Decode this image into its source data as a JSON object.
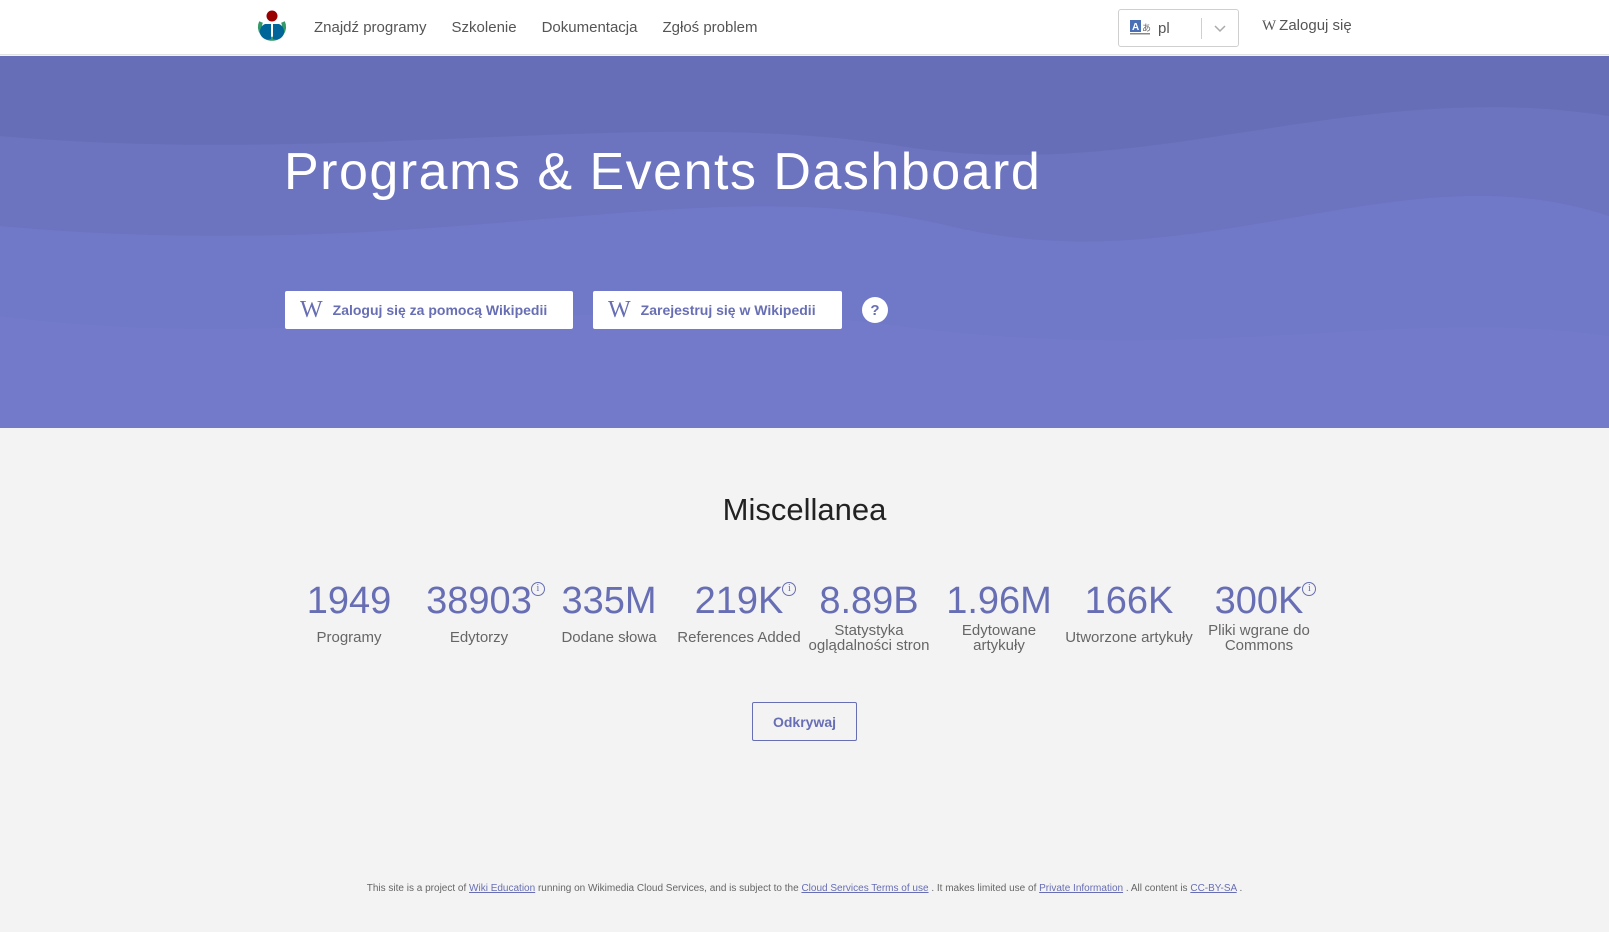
{
  "nav": {
    "links": [
      "Znajdź programy",
      "Szkolenie",
      "Dokumentacja",
      "Zgłoś problem"
    ],
    "language_value": "pl",
    "login_label": "Zaloguj się",
    "wiki_glyph": "W"
  },
  "hero": {
    "title": "Programs & Events Dashboard",
    "login_button": "Zaloguj się za pomocą Wikipedii",
    "register_button": "Zarejestruj się w Wikipedii",
    "help_label": "?"
  },
  "stats": {
    "title": "Miscellanea",
    "info_glyph": "i",
    "items": [
      {
        "value": "1949",
        "label": "Programy"
      },
      {
        "value": "38903",
        "label": "Edytorzy"
      },
      {
        "value": "335M",
        "label": "Dodane słowa"
      },
      {
        "value": "219K",
        "label": "References Added"
      },
      {
        "value": "8.89B",
        "label_line1": "Statystyka",
        "label_line2": "oglądalności stron"
      },
      {
        "value": "1.96M",
        "label_line1": "Edytowane",
        "label_line2": "artykuły"
      },
      {
        "value": "166K",
        "label": "Utworzone artykuły"
      },
      {
        "value": "300K",
        "label_line1": "Pliki wgrane do",
        "label_line2": "Commons"
      }
    ],
    "explore_button": "Odkrywaj"
  },
  "footer": {
    "t1": "This site is a project of",
    "l1": "Wiki Education",
    "t2": "running on Wikimedia Cloud Services, and is subject to the",
    "l2": "Cloud Services Terms of use",
    "t3": ". It makes limited use of",
    "l3": "Private Information",
    "t4": ". All content is",
    "l4": "CC-BY-SA",
    "t5": "."
  },
  "colors": {
    "hero_bg": "#7078c8",
    "accent": "#676eb4",
    "page_bg": "#f3f3f3"
  },
  "icons": [
    "wikimedia-logo",
    "language-icon",
    "chevron-down-icon",
    "wikipedia-w-icon",
    "help-icon",
    "info-icon"
  ]
}
